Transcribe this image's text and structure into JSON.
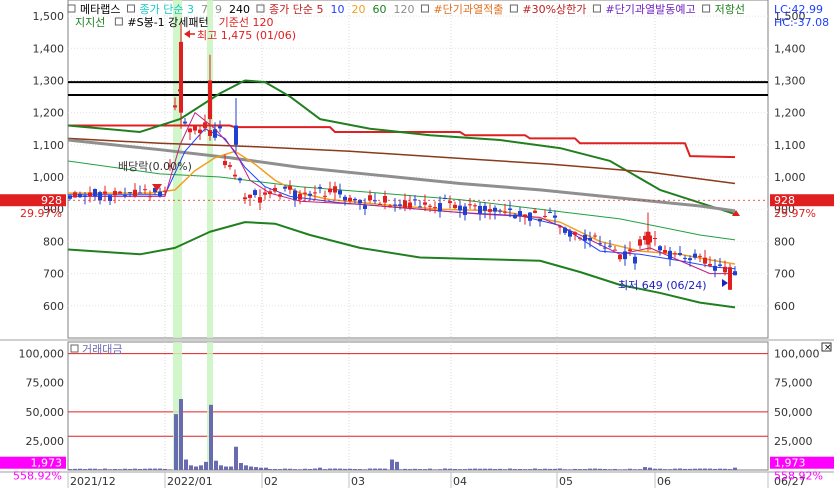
{
  "legend": {
    "row1": [
      {
        "text": "메타랩스",
        "color": "#000000"
      },
      {
        "text": "종가 단순 3",
        "color": "#19c7c7"
      },
      {
        "text": "7",
        "color": "#8f8f8f"
      },
      {
        "text": "9",
        "color": "#8f8f8f"
      },
      {
        "text": "240",
        "color": "#000000"
      },
      {
        "text": "종가 단순 5",
        "color": "#c02020"
      },
      {
        "text": "10",
        "color": "#2040ff"
      },
      {
        "text": "20",
        "color": "#f0a020"
      },
      {
        "text": "60",
        "color": "#208020"
      },
      {
        "text": "120",
        "color": "#8f8f8f"
      },
      {
        "text": "#단기과열적출",
        "color": "#e07020"
      },
      {
        "text": "#30%상한가",
        "color": "#c02020"
      },
      {
        "text": "#단기과열발동예고",
        "color": "#7020c0"
      },
      {
        "text": "저항선",
        "color": "#208020"
      }
    ],
    "row2": [
      {
        "text": "지지선",
        "color": "#208020"
      },
      {
        "text": "#S봉-1 강세패턴",
        "color": "#000000"
      },
      {
        "text": "기준선 120",
        "color": "#e02020"
      }
    ]
  },
  "top_right": {
    "lc": "LC:42.99",
    "hc": "HC:-37.08"
  },
  "price_tag": {
    "value": "928",
    "pct": "29.97%",
    "color": "#e02020"
  },
  "volume_tag": {
    "value": "1,973",
    "pct": "558.92%",
    "color": "#ff00ff"
  },
  "volume_title": "거래대금",
  "annotations": {
    "high": "최고 1,475 (01/06)",
    "low": "최저 649 (06/24)",
    "dividend": "배당락(0.00%)"
  },
  "chart_data": [
    {
      "type": "candlestick",
      "ylim": [
        500,
        1550
      ],
      "y_ticks": [
        "1,500",
        "1,400",
        "1,300",
        "1,200",
        "1,100",
        "1,000",
        "900",
        "800",
        "700",
        "600"
      ],
      "x_ticks": [
        "2021/12",
        "2022/01",
        "02",
        "03",
        "04",
        "05",
        "06",
        "06/27"
      ],
      "resistance_lines": [
        1295,
        1255
      ],
      "series": [
        {
          "name": "5",
          "color": "#c02020"
        },
        {
          "name": "10",
          "color": "#2040ff"
        },
        {
          "name": "20",
          "color": "#f0a020"
        },
        {
          "name": "60",
          "color": "#208020"
        },
        {
          "name": "120",
          "color": "#8f8f8f"
        },
        {
          "name": "240",
          "color": "#000000"
        },
        {
          "name": "기준선 120",
          "color": "#e02020"
        }
      ]
    },
    {
      "type": "bar",
      "ylim": [
        0,
        110000
      ],
      "y_ticks": [
        "100,000",
        "75,000",
        "50,000",
        "25,000"
      ],
      "reference_lines": [
        100000,
        50000,
        29000
      ]
    }
  ]
}
